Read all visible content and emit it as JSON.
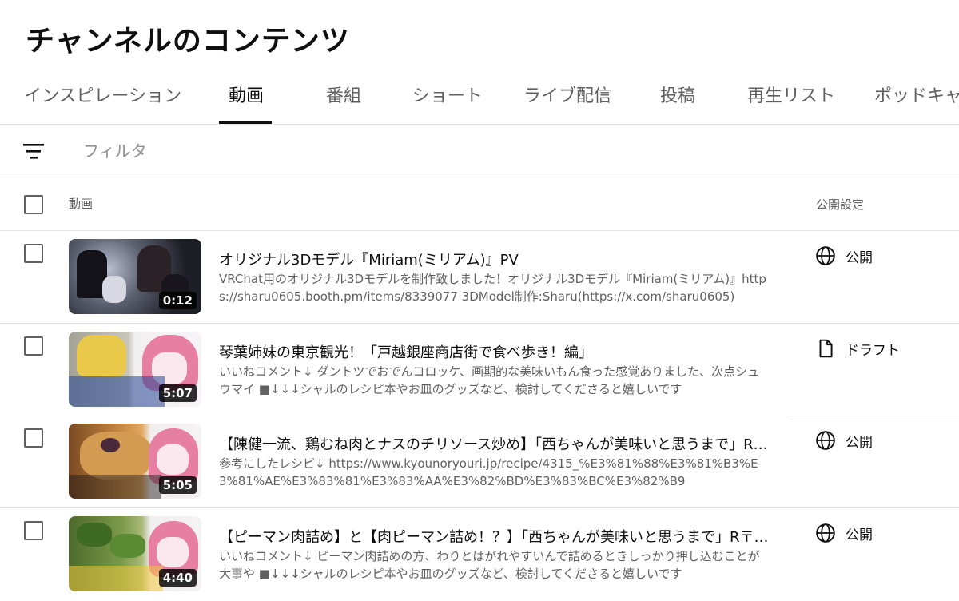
{
  "page": {
    "title": "チャンネルのコンテンツ"
  },
  "tabs": [
    {
      "label": "インスピレーション"
    },
    {
      "label": "動画"
    },
    {
      "label": "番組"
    },
    {
      "label": "ショート"
    },
    {
      "label": "ライブ配信"
    },
    {
      "label": "投稿"
    },
    {
      "label": "再生リスト"
    },
    {
      "label": "ポッドキャスト"
    }
  ],
  "active_tab": "動画",
  "filter": {
    "placeholder": "フィルタ",
    "value": ""
  },
  "table": {
    "columns": {
      "video": "動画",
      "visibility": "公開設定"
    },
    "rows": [
      {
        "title": "オリジナル3Dモデル『Miriam(ミリアム)』PV",
        "description": "VRChat用のオリジナル3Dモデルを制作致しました！オリジナル3Dモデル『Miriam(ミリアム)』https://sharu0605.booth.pm/items/8339077 3DModel制作:Sharu(https://x.com/sharu0605)",
        "duration": "0:12",
        "visibility": "公開",
        "visibility_icon": "globe-icon",
        "thumb_colors": [
          "#2b2b33",
          "#5a5f6e"
        ]
      },
      {
        "title": "琴葉姉妹の東京観光！「戸越銀座商店街で食べ歩き！編」",
        "description": "いいねコメント↓ ダントツでおでんコロッケ、画期的な美味いもん食った感覚ありました、次点シュウマイ ■↓↓↓シャルのレシピ本やお皿のグッズなど、検討してくださると嬉しいです",
        "duration": "5:07",
        "visibility": "ドラフト",
        "visibility_icon": "draft-document-icon",
        "thumb_colors": [
          "#9c9a8e",
          "#e8a0b8"
        ]
      },
      {
        "title": "【陳健一流、鶏むね肉とナスのチリソース炒め】「西ちゃんが美味いと思うまで」R…",
        "description": "参考にしたレシピ↓ https://www.kyounoryouri.jp/recipe/4315_%E3%81%88%E3%81%B3%E3%81%AE%E3%83%81%E3%83%AA%E3%82%BD%E3%83%BC%E3%82%B9",
        "duration": "5:05",
        "visibility": "公開",
        "visibility_icon": "globe-icon",
        "thumb_colors": [
          "#b87a3a",
          "#e890b0"
        ]
      },
      {
        "title": "【ピーマン肉詰め】と【肉ピーマン詰め！？】「西ちゃんが美味いと思うまで」R〒…",
        "description": "いいねコメント↓ ピーマン肉詰めの方、わりとはがれやすいんで詰めるときしっかり押し込むことが大事や ■↓↓↓シャルのレシピ本やお皿のグッズなど、検討してくださると嬉しいです",
        "duration": "4:40",
        "visibility": "公開",
        "visibility_icon": "globe-icon",
        "thumb_colors": [
          "#6f8a4a",
          "#e890b0"
        ]
      }
    ]
  },
  "icons": {
    "filter": "filter-lines-icon",
    "row_checkbox": "checkbox-icon"
  },
  "colors": {
    "text_primary": "#0f0f0f",
    "text_secondary": "#606060",
    "divider": "#e5e5e5",
    "duration_badge": "#000000"
  }
}
